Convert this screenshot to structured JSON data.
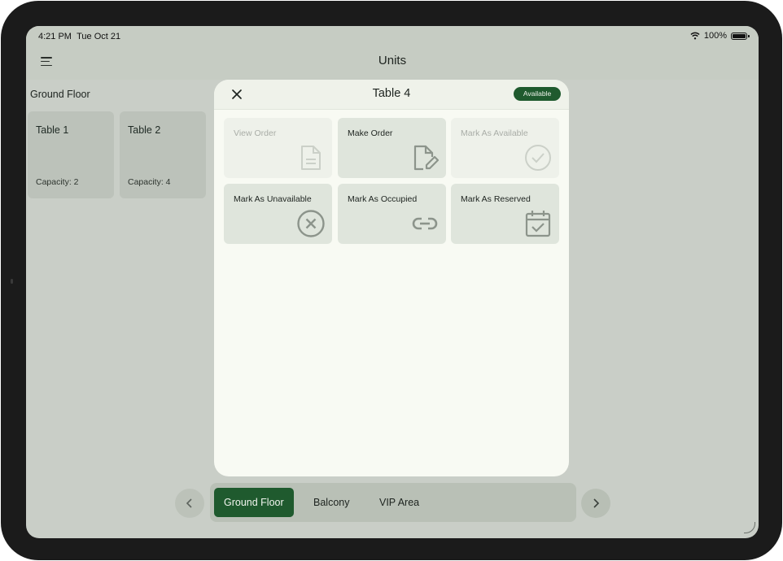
{
  "status_bar": {
    "time": "4:21 PM",
    "date": "Tue Oct 21",
    "battery": "100%"
  },
  "nav": {
    "title": "Units",
    "menu_icon": "hamburger-menu-icon"
  },
  "floor": {
    "label": "Ground Floor",
    "tables": [
      {
        "name": "Table 1",
        "capacity": "Capacity: 2"
      },
      {
        "name": "Table 2",
        "capacity": "Capacity: 4"
      }
    ]
  },
  "modal": {
    "title": "Table 4",
    "status": "Available",
    "actions": [
      {
        "label": "View Order",
        "icon": "document-icon",
        "enabled": false
      },
      {
        "label": "Make Order",
        "icon": "edit-document-icon",
        "enabled": true
      },
      {
        "label": "Mark As Available",
        "icon": "check-circle-icon",
        "enabled": false
      },
      {
        "label": "Mark As Unavailable",
        "icon": "x-circle-icon",
        "enabled": true
      },
      {
        "label": "Mark As Occupied",
        "icon": "link-icon",
        "enabled": true
      },
      {
        "label": "Mark As Reserved",
        "icon": "calendar-check-icon",
        "enabled": true
      }
    ]
  },
  "floor_tabs": {
    "items": [
      "Ground Floor",
      "Balcony",
      "VIP Area"
    ],
    "active": "Ground Floor"
  },
  "colors": {
    "accent": "#1f5a2e",
    "modal_bg": "#f8faf3",
    "tile_bg": "#dfe5dc"
  }
}
